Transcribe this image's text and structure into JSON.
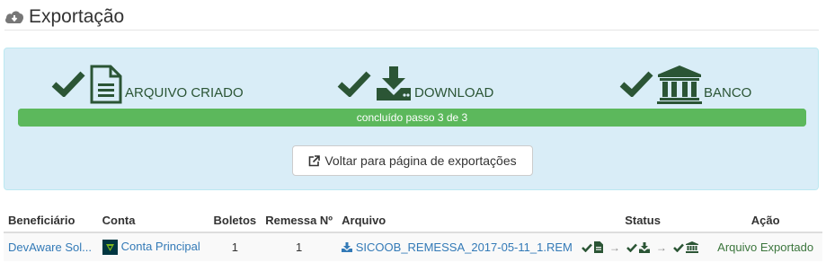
{
  "header": {
    "title": "Exportação"
  },
  "steps": [
    {
      "label": "ARQUIVO CRIADO"
    },
    {
      "label": "DOWNLOAD"
    },
    {
      "label": "BANCO"
    }
  ],
  "progress": {
    "text": "concluído passo 3 de 3",
    "fraction": 1.0
  },
  "back_button": {
    "label": "Voltar para página de exportações"
  },
  "table": {
    "columns": [
      "Beneficiário",
      "Conta",
      "Boletos",
      "Remessa Nº",
      "Arquivo",
      "Status",
      "Ação"
    ],
    "rows": [
      {
        "beneficiario": "DevAware Sol...",
        "conta": "Conta Principal",
        "boletos": "1",
        "remessa": "1",
        "arquivo": "SICOOB_REMESSA_2017-05-11_1.REM",
        "acao": "Arquivo Exportado"
      }
    ]
  },
  "colors": {
    "success_green": "#3c763d",
    "progress_green": "#5cb85c",
    "panel_bg": "#d9edf7",
    "link_blue": "#337ab7"
  },
  "icons": [
    "cloud-download-icon",
    "check-icon",
    "file-text-icon",
    "download-icon",
    "bank-icon",
    "external-link-icon",
    "arrow-right-icon"
  ]
}
